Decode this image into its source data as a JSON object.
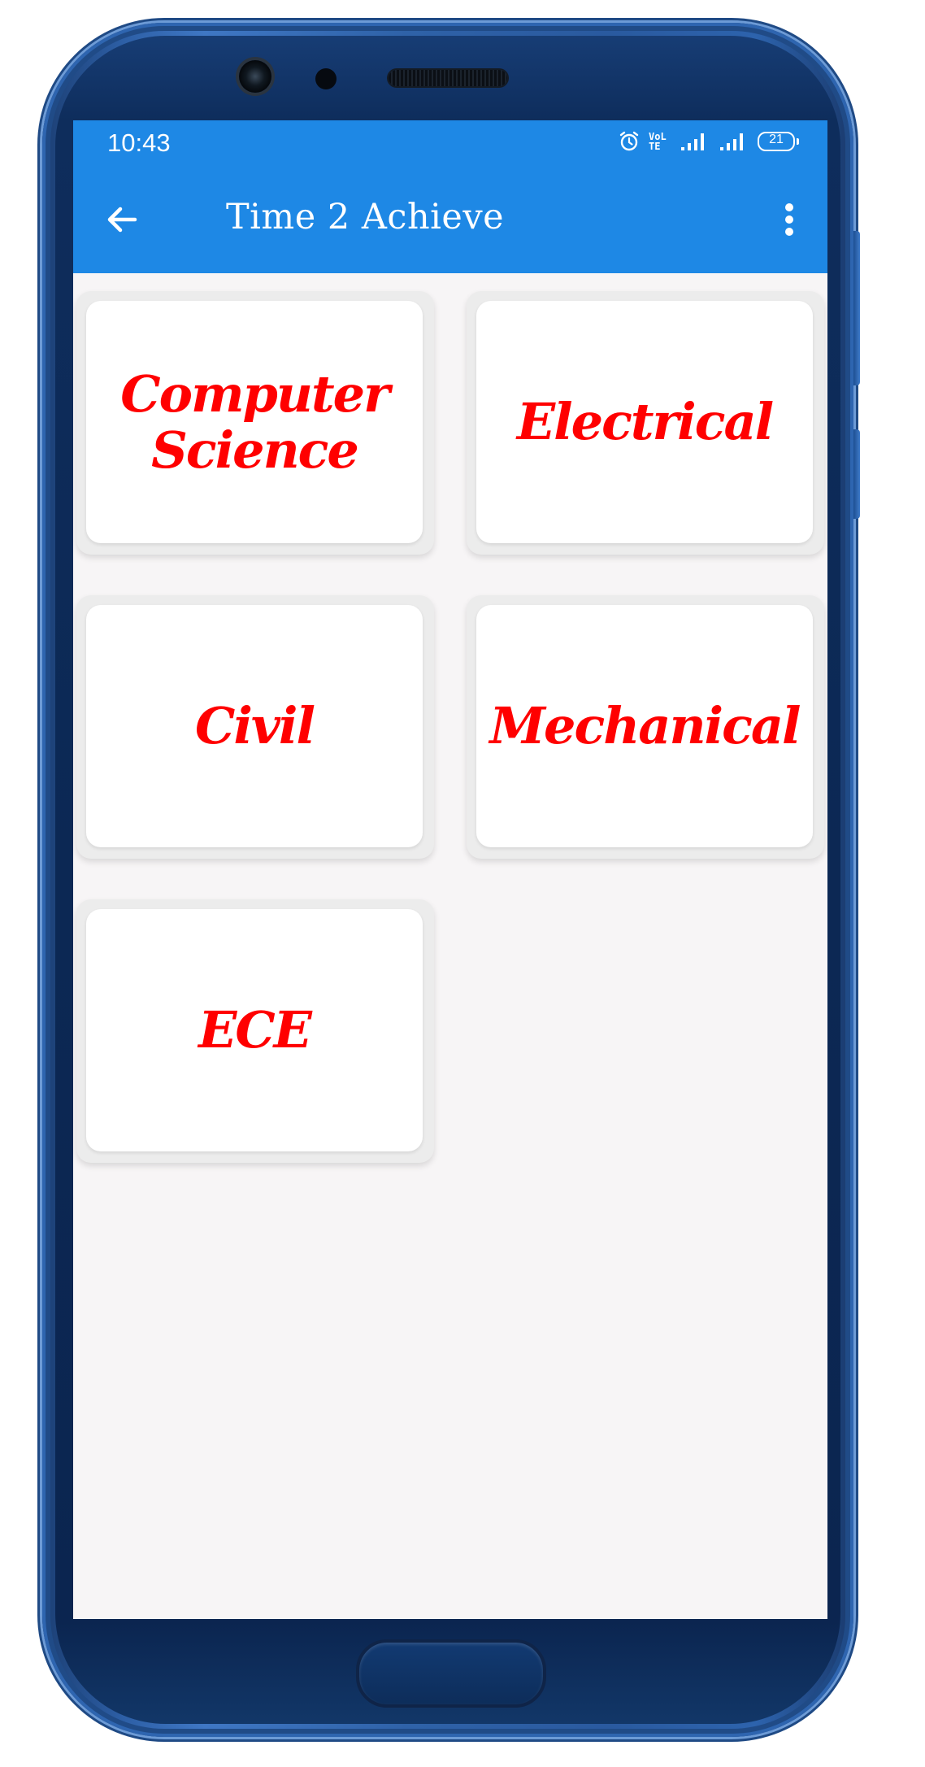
{
  "status_bar": {
    "time": "10:43",
    "battery": "21",
    "volte_label": "VoLTE",
    "icons": [
      "alarm-icon",
      "volte-icon",
      "signal-icon",
      "signal-icon",
      "battery-icon"
    ]
  },
  "app_bar": {
    "title": "Time 2 Achieve",
    "back_icon": "arrow-left-icon",
    "menu_icon": "more-vert-icon"
  },
  "categories": [
    {
      "label": "Computer\nScience"
    },
    {
      "label": "Electrical"
    },
    {
      "label": "Civil"
    },
    {
      "label": "Mechanical"
    },
    {
      "label": "ECE"
    }
  ],
  "colors": {
    "app_bar": "#1e88e5",
    "label": "#ff0000",
    "background": "#f7f5f6"
  }
}
